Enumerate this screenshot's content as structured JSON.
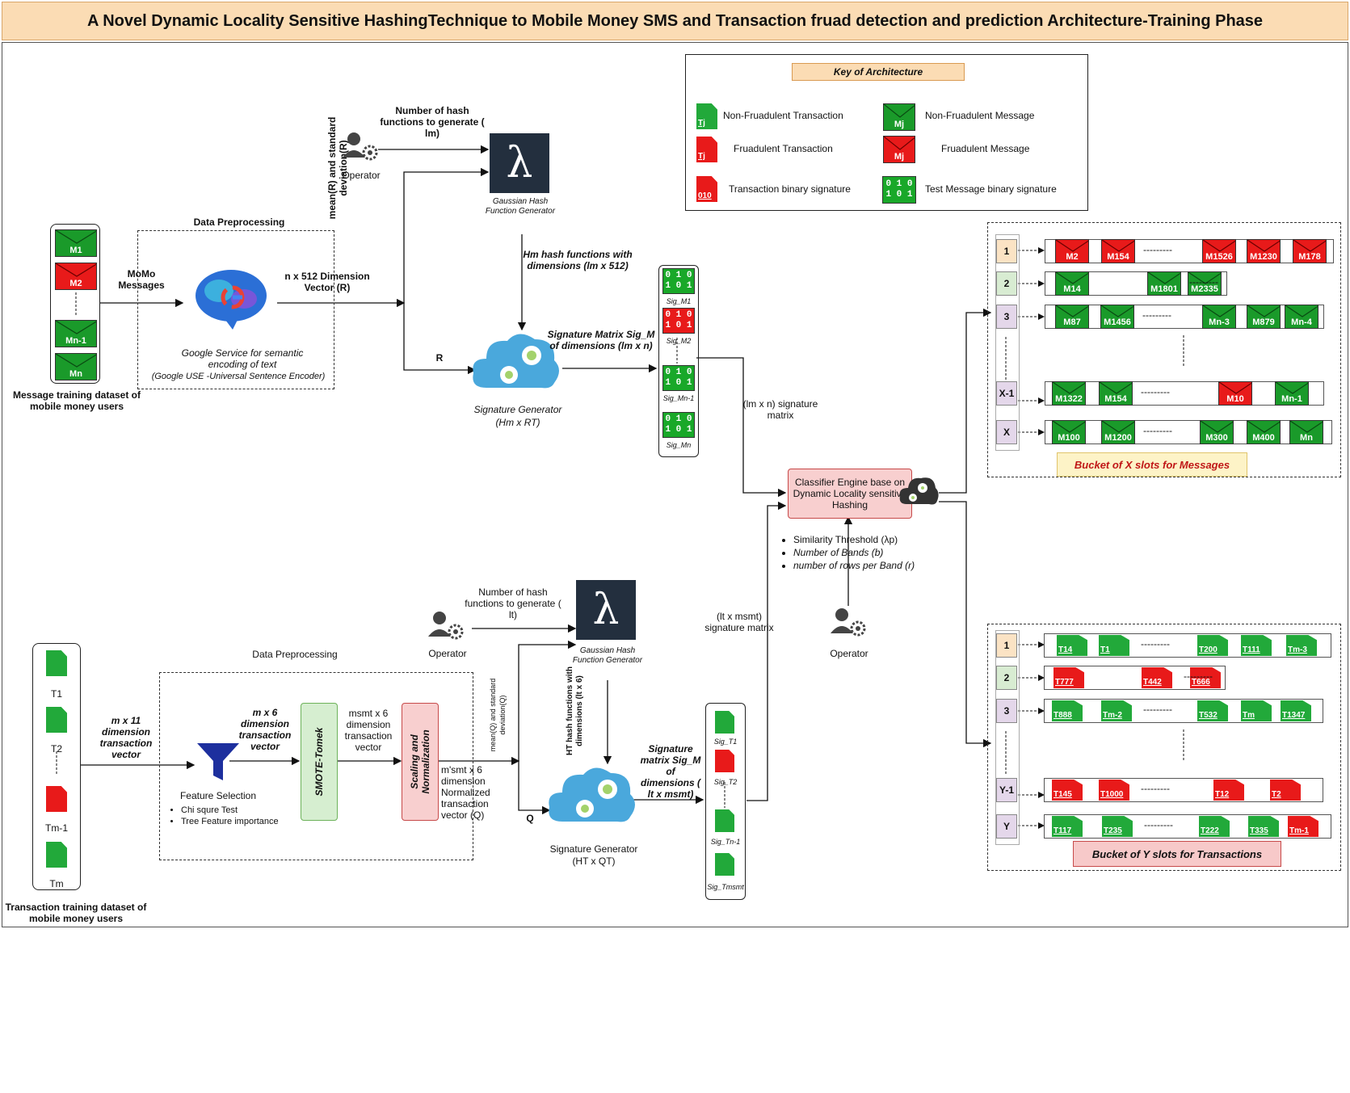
{
  "title": "A Novel Dynamic Locality Sensitive HashingTechnique to Mobile Money SMS and Transaction fruad detection and prediction Architecture-Training Phase",
  "colors": {
    "green": "#1a9a2a",
    "red": "#e81a1a",
    "lambda_bg": "#232f3e",
    "cloud": "#4aa8dc",
    "title_bg": "#fbdcb4"
  },
  "key": {
    "title": "Key of Architecture",
    "non_fraud_txn": "Non-Fruadulent Transaction",
    "fraud_txn": "Fruadulent Transaction",
    "txn_binary": "Transaction binary signature",
    "non_fraud_msg": "Non-Fruadulent Message",
    "fraud_msg": "Fruadulent Message",
    "test_msg_binary": "Test  Message binary signature",
    "msg_icon": "Mj",
    "txn_icon": "Tj"
  },
  "message_section": {
    "dataset_label": "Message training dataset of mobile money users",
    "messages": [
      "M1",
      "M2",
      "Mn-1",
      "Mn"
    ],
    "momo_label": "MoMo Messages",
    "preprocessing_title": "Data Preprocessing",
    "google_label_1": "Google Service for semantic encoding of text",
    "google_label_2": "(Google USE -Universal Sentence Encoder)",
    "vector_label": "n x 512 Dimension Vector (R)",
    "mean_std_label": "mean(R) and standard deviation(R)",
    "r_label": "R",
    "operator": "Operator",
    "num_hash_label": "Number of hash functions to generate ( lm)",
    "gaussian_label": "Gaussian Hash Function Generator",
    "hm_label": "Hm hash functions with dimensions (lm x 512)",
    "sig_matrix_label": "Signature Matrix Sig_M of dimensions (lm x n)",
    "sig_gen_label": "Signature Generator",
    "sig_gen_formula": "(Hm x RT)",
    "sig_items": [
      "Sig_M1",
      "Sig_M2",
      "Sig_Mn-1",
      "Sig_Mn"
    ],
    "sig_matrix_out": "(lm x n) signature matrix"
  },
  "transaction_section": {
    "dataset_label": "Transaction training dataset of mobile money users",
    "transactions": [
      "T1",
      "T2",
      "Tm-1",
      "Tm"
    ],
    "mx11_label": "m x 11 dimension transaction vector",
    "preprocessing_title": "Data Preprocessing",
    "feature_sel": "Feature Selection",
    "feature_items": [
      "Chi squre Test",
      "Tree Feature importance"
    ],
    "mx6_label": "m x 6 dimension transaction vector",
    "smote": "SMOTE-Tomek",
    "msmt_label": "msmt x 6 dimension transaction vector",
    "scaling": "Scaling and Normalization",
    "norm_label": "m'smt x 6 dimension Normalized transaction vector (Q)",
    "mean_std_label": "mean(Q) and standard deviation(Q)",
    "q_label": "Q",
    "operator": "Operator",
    "num_hash_label": "Number of hash functions to generate ( lt)",
    "gaussian_label": "Gaussian Hash Function Generator",
    "ht_label": "HT hash functions with dimensions (lt x 6)",
    "sig_matrix_label": "Signature matrix Sig_M of dimensions ( lt x msmt)",
    "sig_gen_label": "Signature Generator",
    "sig_gen_formula": "(HT x QT)",
    "sig_items": [
      "Sig_T1",
      "Sig_T2",
      "Sig_Tn-1",
      "Sig_Tmsmt"
    ],
    "sig_matrix_out": "(lt x msmt) signature matrix"
  },
  "classifier": {
    "label": "Classifier Engine base on Dynamic Locality sensitive Hashing",
    "params": [
      "Similarity Threshold (λp)",
      "Number of Bands (b)",
      "number of  rows per Band (r)"
    ],
    "operator": "Operator"
  },
  "bucket_messages": {
    "label": "Bucket of X slots for  Messages",
    "slots": [
      {
        "num": "1",
        "items": [
          [
            "M2",
            "r"
          ],
          [
            "M154",
            "r"
          ],
          [
            "M1526",
            "r"
          ],
          [
            "M1230",
            "r"
          ],
          [
            "M178",
            "r"
          ]
        ]
      },
      {
        "num": "2",
        "items": [
          [
            "M14",
            "g"
          ],
          [
            "M1801",
            "g"
          ],
          [
            "M2335",
            "g"
          ]
        ]
      },
      {
        "num": "3",
        "items": [
          [
            "M87",
            "g"
          ],
          [
            "M1456",
            "g"
          ],
          [
            "Mn-3",
            "g"
          ],
          [
            "M879",
            "g"
          ],
          [
            "Mn-4",
            "g"
          ]
        ]
      },
      {
        "num": "X-1",
        "items": [
          [
            "M1322",
            "g"
          ],
          [
            "M154",
            "g"
          ],
          [
            "M10",
            "r"
          ],
          [
            "Mn-1",
            "g"
          ]
        ]
      },
      {
        "num": "X",
        "items": [
          [
            "M100",
            "g"
          ],
          [
            "M1200",
            "g"
          ],
          [
            "M300",
            "g"
          ],
          [
            "M400",
            "g"
          ],
          [
            "Mn",
            "g"
          ]
        ]
      }
    ]
  },
  "bucket_transactions": {
    "label": "Bucket of Y slots for  Transactions",
    "slots": [
      {
        "num": "1",
        "items": [
          [
            "T14",
            "g"
          ],
          [
            "T1",
            "g"
          ],
          [
            "T200",
            "g"
          ],
          [
            "T111",
            "g"
          ],
          [
            "Tm-3",
            "g"
          ]
        ]
      },
      {
        "num": "2",
        "items": [
          [
            "T777",
            "r"
          ],
          [
            "T442",
            "r"
          ],
          [
            "T666",
            "r"
          ]
        ]
      },
      {
        "num": "3",
        "items": [
          [
            "T888",
            "g"
          ],
          [
            "Tm-2",
            "g"
          ],
          [
            "T532",
            "g"
          ],
          [
            "Tm",
            "g"
          ],
          [
            "T1347",
            "g"
          ]
        ]
      },
      {
        "num": "Y-1",
        "items": [
          [
            "T145",
            "r"
          ],
          [
            "T1000",
            "r"
          ],
          [
            "T12",
            "r"
          ],
          [
            "T2",
            "r"
          ]
        ]
      },
      {
        "num": "Y",
        "items": [
          [
            "T117",
            "g"
          ],
          [
            "T235",
            "g"
          ],
          [
            "T222",
            "g"
          ],
          [
            "T335",
            "g"
          ],
          [
            "Tm-1",
            "r"
          ]
        ]
      }
    ]
  },
  "binary": {
    "row1": "0 1 0",
    "row2": "1 0 1",
    "tx1": "101",
    "tx2": "010",
    "tx3": "101"
  },
  "dots": "---------"
}
